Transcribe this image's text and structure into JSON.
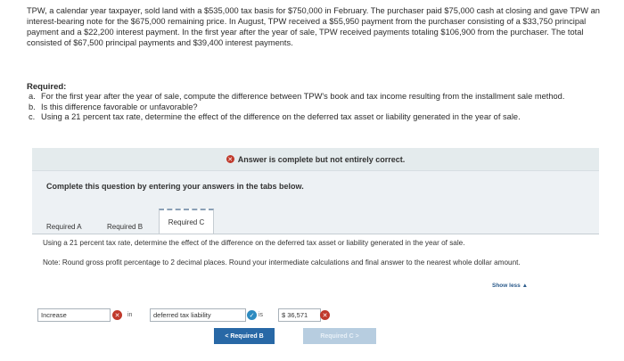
{
  "problem_text": "TPW, a calendar year taxpayer, sold land with a $535,000 tax basis for $750,000 in February. The purchaser paid $75,000 cash at closing and gave TPW an interest-bearing note for the $675,000 remaining price. In August, TPW received a $55,950 payment from the purchaser consisting of a $33,750 principal payment and a $22,200 interest payment. In the first year after the year of sale, TPW received payments totaling $106,900 from the purchaser. The total consisted of $67,500 principal payments and $39,400 interest payments.",
  "required_heading": "Required:",
  "requirements": [
    {
      "letter": "a.",
      "text": "For the first year after the year of sale, compute the difference between TPW's book and tax income resulting from the installment sale method."
    },
    {
      "letter": "b.",
      "text": "Is this difference favorable or unfavorable?"
    },
    {
      "letter": "c.",
      "text": "Using a 21 percent tax rate, determine the effect of the difference on the deferred tax asset or liability generated in the year of sale."
    }
  ],
  "banner_text": "Answer is complete but not entirely correct.",
  "instruction": "Complete this question by entering your answers in the tabs below.",
  "tabs": [
    "Required A",
    "Required B",
    "Required C"
  ],
  "question": "Using a 21 percent tax rate, determine the effect of the difference on the deferred tax asset or liability generated in the year of sale.",
  "note": "Note: Round gross profit percentage to 2 decimal places. Round your intermediate calculations and final answer to the nearest whole dollar amount.",
  "show_less": "Show less ▲",
  "answer": {
    "field1": "Increase",
    "word1": "in",
    "field2": "deferred tax liability",
    "word2": "is",
    "field3": "$ 36,571"
  },
  "nav": {
    "prev": "< Required B",
    "next": "Required C >"
  },
  "colors": {
    "accent": "#2868a6",
    "error": "#c0392b",
    "correct": "#2e8bc0"
  }
}
